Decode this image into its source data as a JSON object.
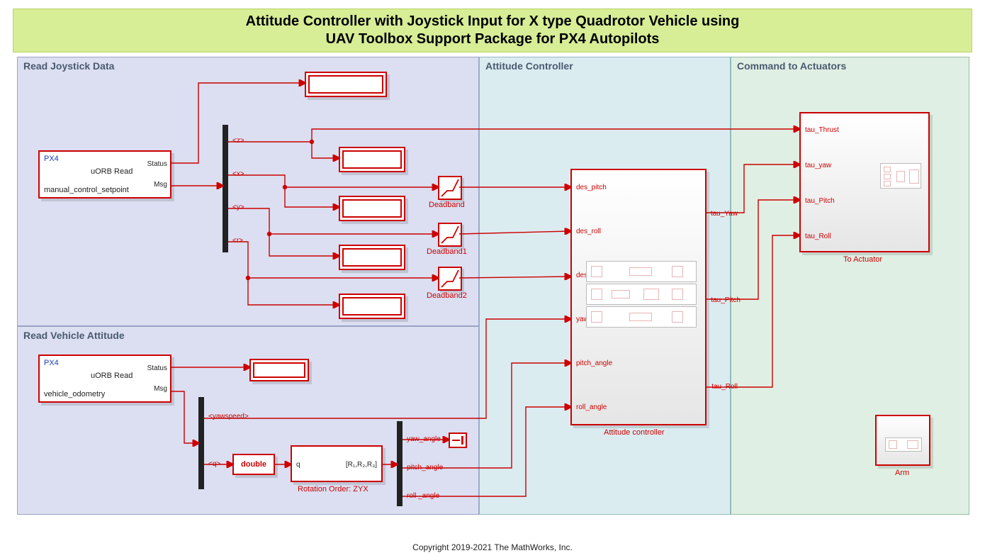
{
  "title": {
    "line1": "Attitude Controller with Joystick Input for X type Quadrotor Vehicle using",
    "line2": "UAV Toolbox Support Package for PX4 Autopilots"
  },
  "copyright": "Copyright 2019-2021 The MathWorks, Inc.",
  "regions": {
    "joystick": "Read Joystick Data",
    "vehicle": "Read Vehicle Attitude",
    "attitude": "Attitude Controller",
    "command": "Command to Actuators"
  },
  "blocks": {
    "uorb_joy": {
      "px4": "PX4",
      "name": "uORB Read",
      "topic": "manual_control_setpoint",
      "ports": {
        "status": "Status",
        "msg": "Msg"
      }
    },
    "bus_joy": {
      "signals": [
        "<z>",
        "<x>",
        "<y>",
        "<r>"
      ]
    },
    "deadbands": [
      "Deadband",
      "Deadband1",
      "Deadband2"
    ],
    "uorb_veh": {
      "px4": "PX4",
      "name": "uORB Read",
      "topic": "vehicle_odometry",
      "ports": {
        "status": "Status",
        "msg": "Msg"
      }
    },
    "bus_veh": {
      "signals": [
        "<yawspeed>",
        "<q>"
      ]
    },
    "cast": "double",
    "quat2eul": {
      "in": "q",
      "out": "[R₁,R₂,R₃]",
      "label": "Rotation Order: ZYX"
    },
    "demux_ang": {
      "signals": [
        "yaw_angle",
        "pitch_angle",
        "roll _angle"
      ]
    },
    "att_ctrl": {
      "label": "Attitude controller",
      "inports": [
        "des_pitch",
        "des_roll",
        "des_yaw_rate",
        "yaw_rate",
        "pitch_angle",
        "roll_angle"
      ],
      "outports": [
        "tau_Yaw",
        "tau_Pitch",
        "tau_Roll"
      ]
    },
    "to_actuator": {
      "label": "To Actuator",
      "inports": [
        "tau_Thrust",
        "tau_yaw",
        "tau_Pitch",
        "tau_Roll"
      ]
    },
    "arm": {
      "label": "Arm"
    }
  }
}
